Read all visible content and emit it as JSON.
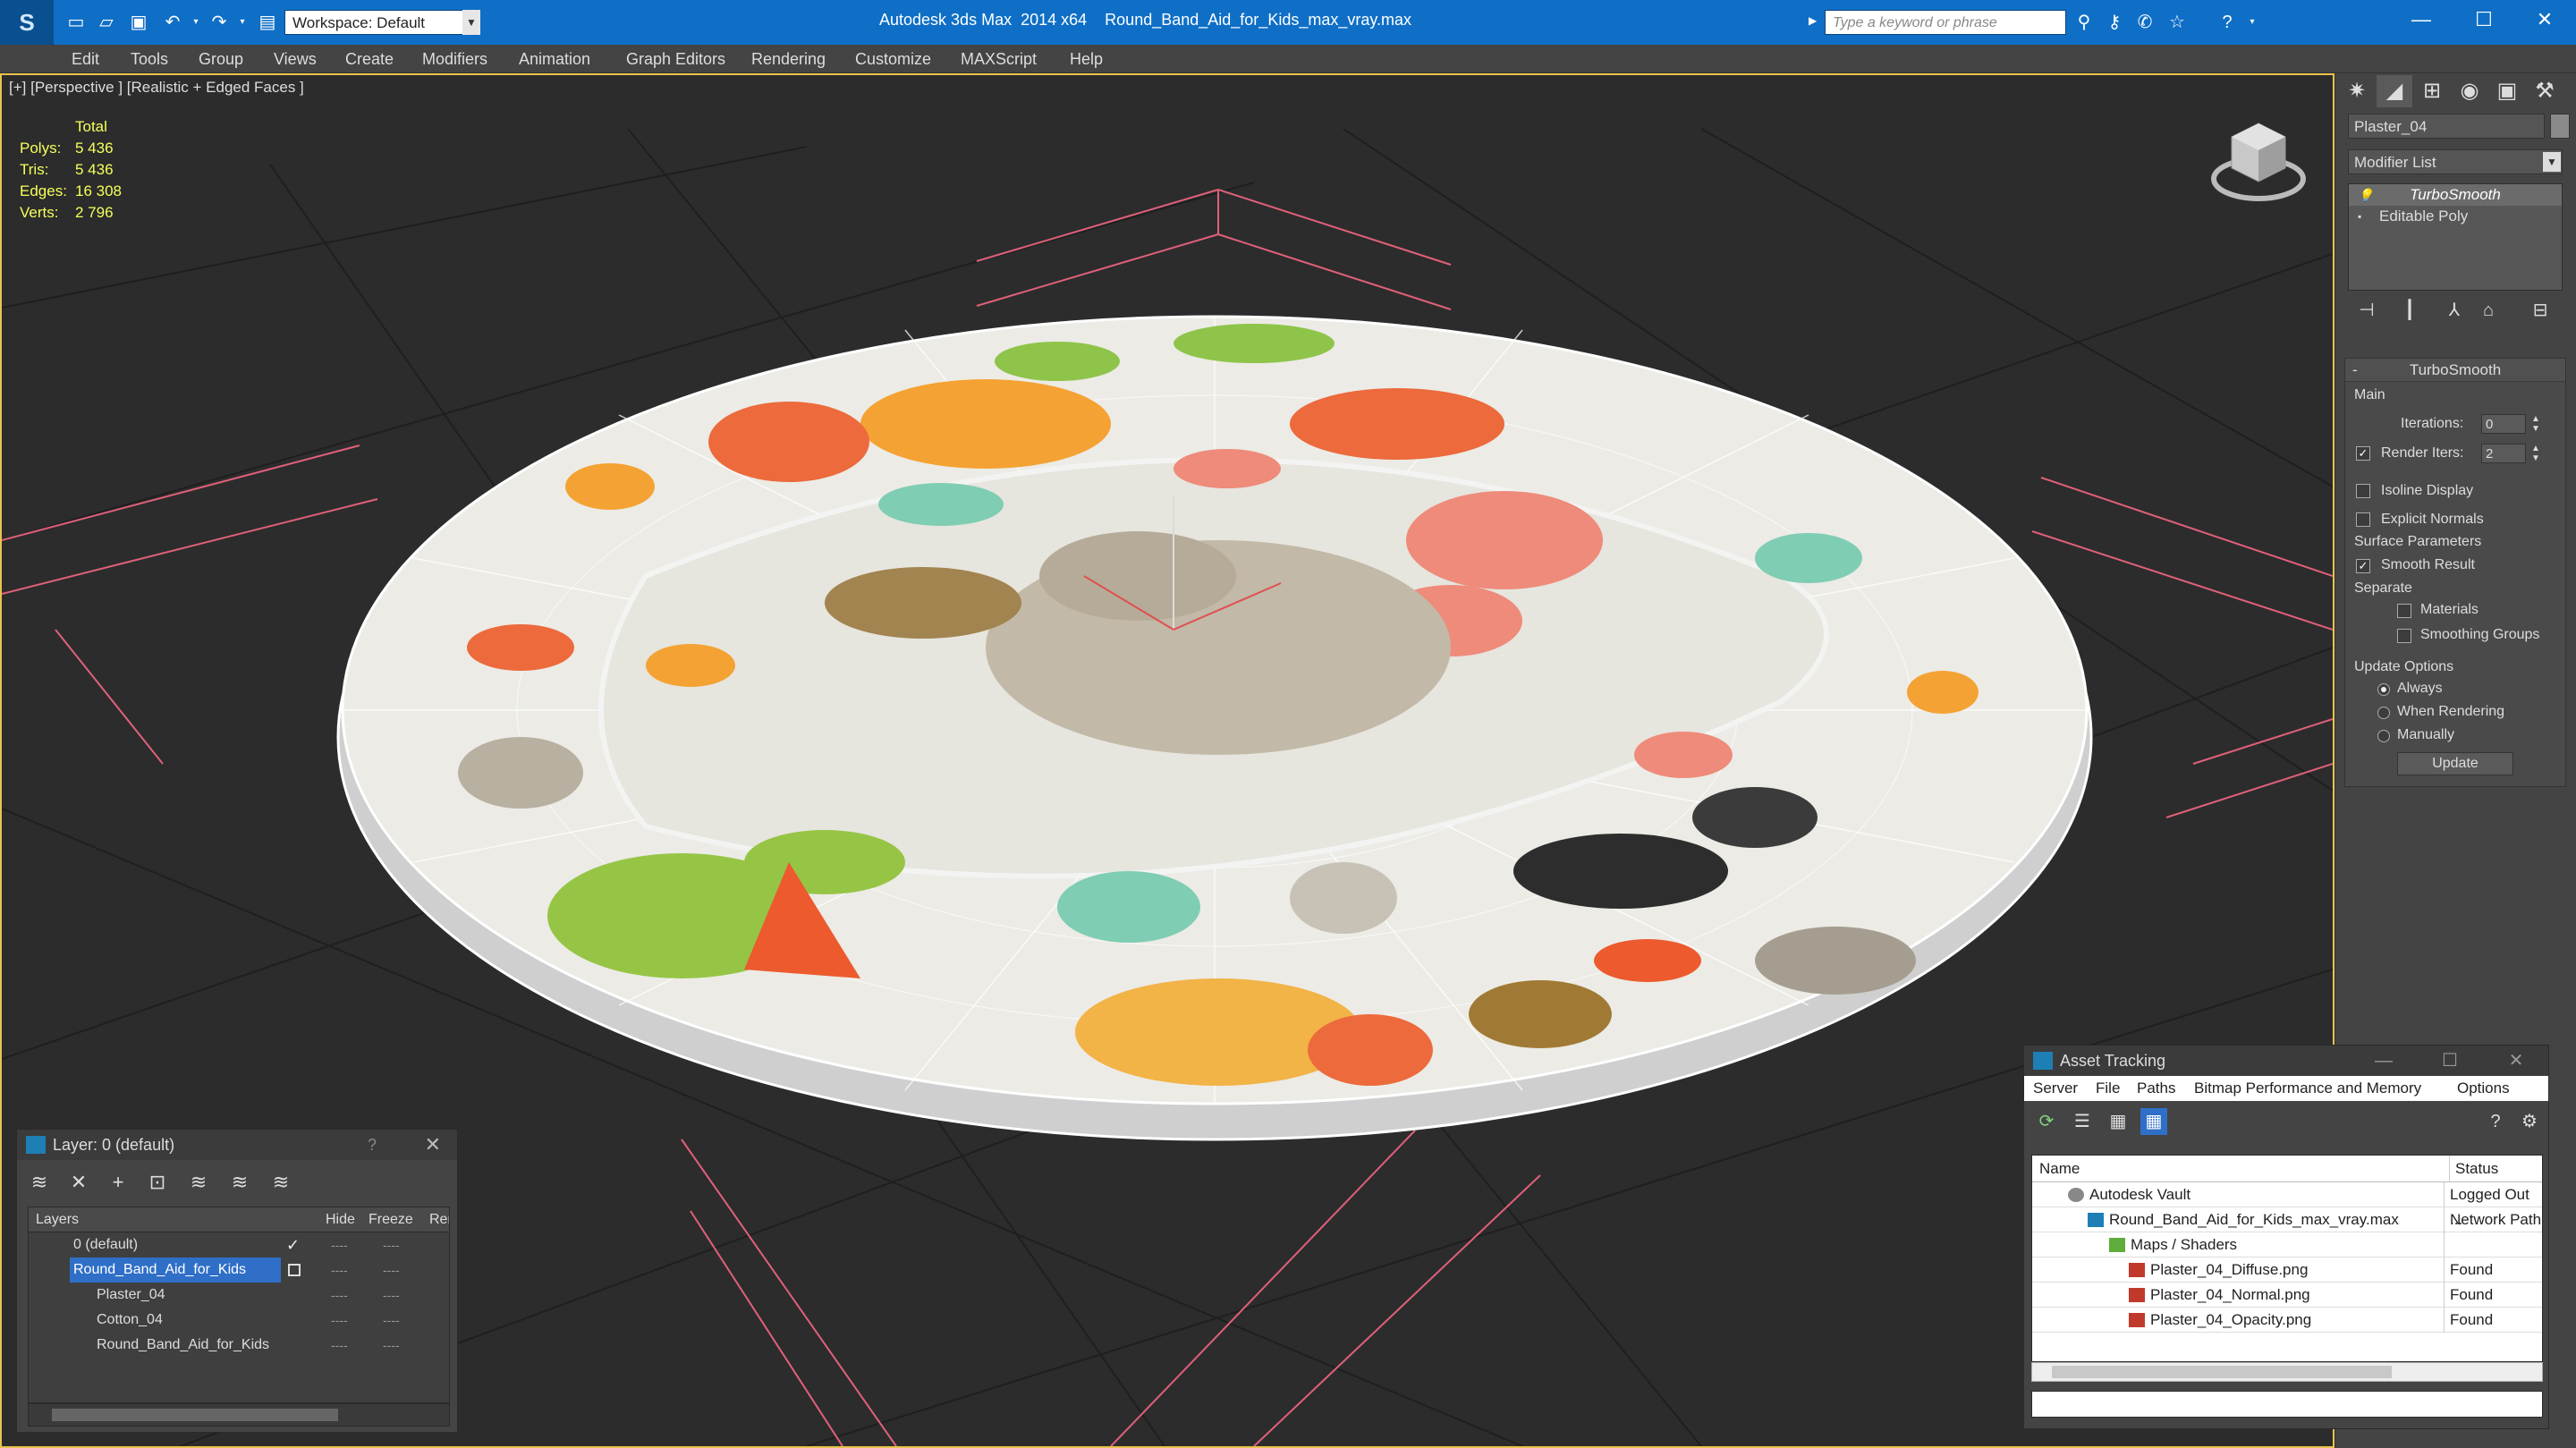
{
  "titlebar": {
    "workspace": "Workspace: Default",
    "app_title": "Autodesk 3ds Max  2014 x64",
    "file_name": "Round_Band_Aid_for_Kids_max_vray.max",
    "search_placeholder": "Type a keyword or phrase",
    "min": "—",
    "max": "☐",
    "close": "✕"
  },
  "menu": [
    "Edit",
    "Tools",
    "Group",
    "Views",
    "Create",
    "Modifiers",
    "Animation",
    "Graph Editors",
    "Rendering",
    "Customize",
    "MAXScript",
    "Help"
  ],
  "viewport": {
    "label": "[+] [Perspective ] [Realistic + Edged Faces ]",
    "stats": {
      "header": "Total",
      "rows": [
        {
          "k": "Polys:",
          "v": "5 436"
        },
        {
          "k": "Tris:",
          "v": "5 436"
        },
        {
          "k": "Edges:",
          "v": "16 308"
        },
        {
          "k": "Verts:",
          "v": "2 796"
        }
      ]
    }
  },
  "command_panel": {
    "object_name": "Plaster_04",
    "modifier_list": "Modifier List",
    "stack": [
      "TurboSmooth",
      "Editable Poly"
    ],
    "rollout_title": "TurboSmooth",
    "main_label": "Main",
    "iterations_label": "Iterations:",
    "iterations_value": "0",
    "render_iters_label": "Render Iters:",
    "render_iters_value": "2",
    "isoline": "Isoline Display",
    "explicit_normals": "Explicit Normals",
    "surface_params": "Surface Parameters",
    "smooth_result": "Smooth Result",
    "separate": "Separate",
    "materials": "Materials",
    "smoothing_groups": "Smoothing Groups",
    "update_options": "Update Options",
    "always": "Always",
    "when_rendering": "When Rendering",
    "manually": "Manually",
    "update": "Update"
  },
  "layers": {
    "title": "Layer: 0 (default)",
    "help": "?",
    "close": "✕",
    "columns": [
      "Layers",
      "Hide",
      "Freeze",
      "Ren"
    ],
    "rows": [
      {
        "name": "0 (default)",
        "indent": 0
      },
      {
        "name": "Round_Band_Aid_for_Kids",
        "indent": 0
      },
      {
        "name": "Plaster_04",
        "indent": 1
      },
      {
        "name": "Cotton_04",
        "indent": 1
      },
      {
        "name": "Round_Band_Aid_for_Kids",
        "indent": 1
      }
    ],
    "dash": "----",
    "check": "✓"
  },
  "asset": {
    "title": "Asset Tracking",
    "menu": [
      "Server",
      "File",
      "Paths",
      "Bitmap Performance and Memory",
      "Options"
    ],
    "columns": [
      "Name",
      "Status"
    ],
    "rows": [
      {
        "name": "Autodesk Vault",
        "status": "Logged Out ..."
      },
      {
        "name": "Round_Band_Aid_for_Kids_max_vray.max",
        "status": "Network Path"
      },
      {
        "name": "Maps / Shaders",
        "status": ""
      },
      {
        "name": "Plaster_04_Diffuse.png",
        "status": "Found"
      },
      {
        "name": "Plaster_04_Normal.png",
        "status": "Found"
      },
      {
        "name": "Plaster_04_Opacity.png",
        "status": "Found"
      }
    ]
  },
  "colors": {
    "titlebar": "#0f6fc6",
    "viewport_bg": "#2c2c2c",
    "stats": "#f5ff5a",
    "grid_pink": "#e0607a",
    "selection": "#2f6fc8"
  }
}
